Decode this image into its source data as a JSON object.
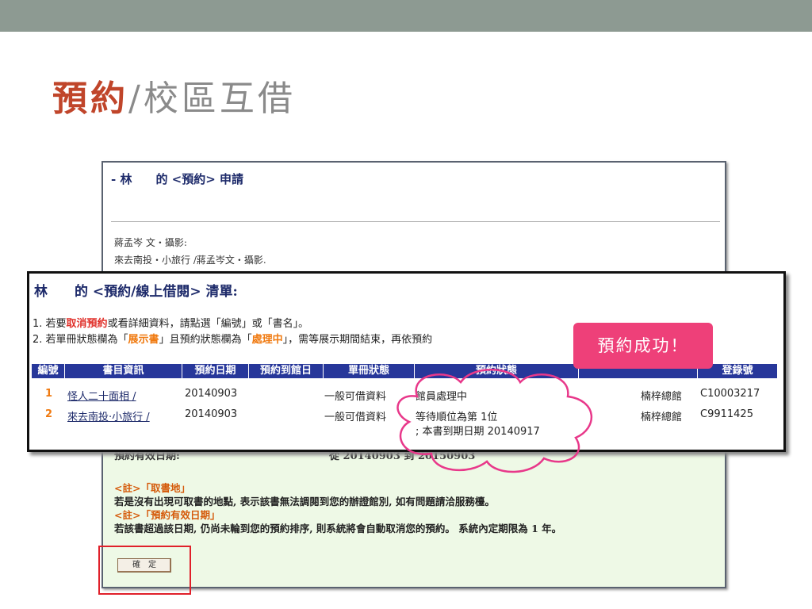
{
  "slide": {
    "title_part1": "預約",
    "title_part2": "/校區互借"
  },
  "apply_panel": {
    "title": "- 林　　的 <預約> 申請",
    "book_lines": [
      "蔣孟岑 文‧攝影:",
      "來去南投‧小旅行 /蔣孟岑文‧攝影."
    ],
    "valid_label": "預約有效日期:",
    "valid_range": "從 20140903 到 20150903",
    "notes": [
      {
        "kind": "head",
        "text": "<註>「取書地」"
      },
      {
        "kind": "body",
        "text": "若是沒有出現可取書的地點, 表示該書無法調閱到您的辦證館別, 如有問題請洽服務檯。"
      },
      {
        "kind": "head",
        "text": "<註>「預約有效日期」"
      },
      {
        "kind": "body",
        "text": "若該書超過該日期, 仍尚未輪到您的預約排序, 則系統將會自動取消您的預約。 系統內定期限為 1 年。"
      }
    ],
    "ok_label": "確　定"
  },
  "list_panel": {
    "title": "林　　的 <預約/線上借閱> 清單:",
    "instr1": {
      "a": "1. 若要",
      "b": "取消預約",
      "c": "或看詳細資料，請點選「編號」或「書名」。"
    },
    "instr2": {
      "a": "2. 若單冊狀態欄為「",
      "b": "展示書",
      "c": "」且預約狀態欄為「",
      "d": "處理中",
      "e": "」，需等展示期間結束，再依預約"
    },
    "headers": [
      "編號",
      "書目資訊",
      "預約日期",
      "預約到館日",
      "單冊狀態",
      "預約狀態",
      "",
      "登錄號"
    ],
    "rows": [
      {
        "no": "1",
        "title": "怪人二十面相 /",
        "date": "20140903",
        "arrive": "",
        "item_status": "一般可借資料",
        "status": "館員處理中",
        "status2": "",
        "branch": "楠梓總館",
        "barcode": "C10003217"
      },
      {
        "no": "2",
        "title": "來去南投‧小旅行 /",
        "date": "20140903",
        "arrive": "",
        "item_status": "一般可借資料",
        "status": "等待順位為第 1位",
        "status2": "; 本書到期日期 20140917",
        "branch": "楠梓總館",
        "barcode": "C9911425"
      }
    ]
  },
  "callout": {
    "success_text": "預約成功！"
  },
  "colors": {
    "topbar": "#8d9a92",
    "title_accent": "#c0452a",
    "table_header": "#27379a",
    "badge": "#ee4079",
    "cloud_stroke": "#e8388a",
    "highlight_box": "#e0202a"
  }
}
